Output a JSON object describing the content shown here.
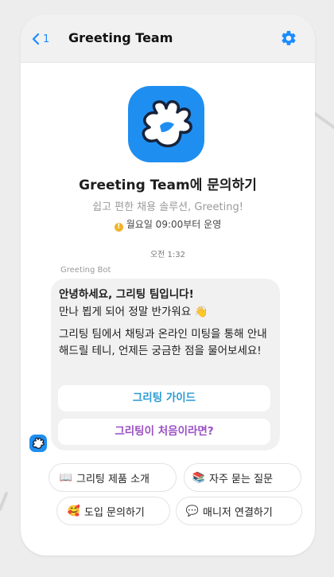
{
  "header": {
    "back_count": "1",
    "title": "Greeting Team"
  },
  "profile": {
    "heading": "Greeting Team에 문의하기",
    "subheading": "쉽고 편한 채용 솔루션, Greeting!",
    "hours": "월요일 09:00부터 운영"
  },
  "chat": {
    "timestamp": "오전 1:32",
    "bot_name": "Greeting Bot",
    "greeting": "안녕하세요, 그리팅 팀입니다!",
    "line2": "만나 뵙게 되어 정말 반가워요 👋",
    "paragraph": "그리팅 팀에서 채팅과 온라인 미팅을 통해 안내해드릴 테니, 언제든 궁금한 점을 물어보세요!",
    "buttons": [
      {
        "label": "그리팅 가이드"
      },
      {
        "label": "그리팅이 처음이라면?"
      }
    ]
  },
  "quick_replies": [
    {
      "emoji": "📖",
      "label": "그리팅 제품 소개"
    },
    {
      "emoji": "📚",
      "label": "자주 묻는 질문"
    },
    {
      "emoji": "🥰",
      "label": "도입 문의하기"
    },
    {
      "emoji": "💬",
      "label": "매니저 연결하기"
    }
  ],
  "colors": {
    "accent": "#1f8ef1",
    "link_blue": "#2a9bd4",
    "link_purple": "#9b4fc4",
    "warning": "#f0b429"
  }
}
